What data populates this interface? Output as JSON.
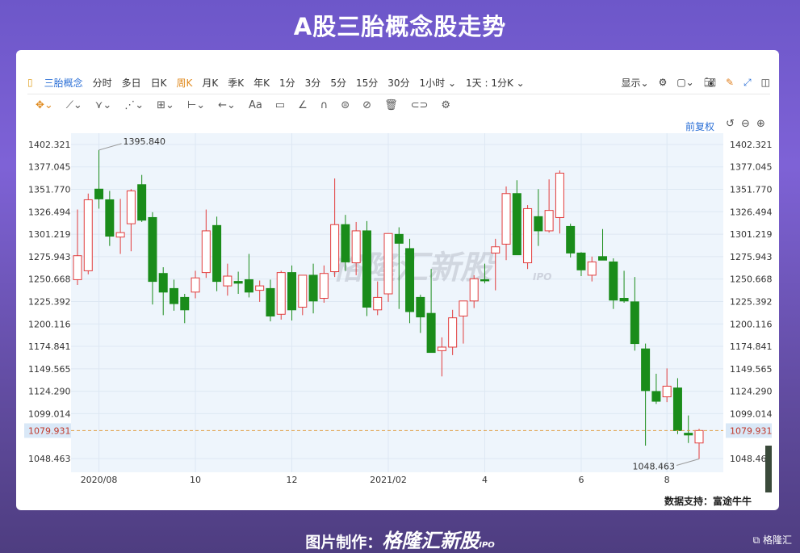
{
  "title": "A股三胎概念股走势",
  "toolbar": {
    "stock_name": "三胎概念",
    "periods": [
      "分时",
      "多日",
      "日K",
      "周K",
      "月K",
      "季K",
      "年K",
      "1分",
      "3分",
      "5分",
      "15分",
      "30分",
      "1小时 ⌄",
      "1天 : 1分K ⌄"
    ],
    "active_period": "周K",
    "display": "显示⌄"
  },
  "drawing_tools": [
    "✥⌄",
    "⟋⌄",
    "⋎⌄",
    "⋰⌄",
    "⊞⌄",
    "⊢⌄",
    "←⌄",
    "Aa",
    "▭",
    "∠",
    "∩",
    "⊜",
    "⊘",
    "🗑",
    "⊂⊃",
    "⚙"
  ],
  "restore_label": "前复权",
  "watermark": "格隆汇新股",
  "watermark_ipo": "IPO",
  "source": "数据支持：富途牛牛",
  "credit_label": "图片制作：",
  "credit_brand": "格隆汇新股",
  "credit_ipo": "IPO",
  "corner_brand": "格隆汇",
  "colors": {
    "up": "#e23c3c",
    "down": "#1a8c1a",
    "current_line": "#e09a3c",
    "axis_highlight": "#d9e8f7"
  },
  "chart_data": {
    "type": "candlestick",
    "title": "",
    "ylim": [
      1033,
      1415
    ],
    "y_ticks": [
      "1402.321",
      "1377.045",
      "1351.770",
      "1326.494",
      "1301.219",
      "1275.943",
      "1250.668",
      "1225.392",
      "1200.116",
      "1174.841",
      "1149.565",
      "1124.290",
      "1099.014",
      "1048.463"
    ],
    "x_tick_labels": [
      {
        "label": "2020/08",
        "index": 2
      },
      {
        "label": "10",
        "index": 11
      },
      {
        "label": "12",
        "index": 20
      },
      {
        "label": "2021/02",
        "index": 29
      },
      {
        "label": "4",
        "index": 38
      },
      {
        "label": "6",
        "index": 47
      },
      {
        "label": "8",
        "index": 55
      }
    ],
    "current_value": "1079.931",
    "high_annotation": {
      "label": "1395.840",
      "index": 2
    },
    "low_annotation": {
      "label": "1048.463",
      "index": 58
    },
    "candles": [
      {
        "o": 1250,
        "h": 1329,
        "l": 1244,
        "c": 1277
      },
      {
        "o": 1260,
        "h": 1347,
        "l": 1256,
        "c": 1340
      },
      {
        "o": 1352,
        "h": 1396,
        "l": 1330,
        "c": 1341
      },
      {
        "o": 1340,
        "h": 1350,
        "l": 1288,
        "c": 1299
      },
      {
        "o": 1298,
        "h": 1341,
        "l": 1279,
        "c": 1303
      },
      {
        "o": 1313,
        "h": 1352,
        "l": 1282,
        "c": 1350
      },
      {
        "o": 1357,
        "h": 1368,
        "l": 1315,
        "c": 1317
      },
      {
        "o": 1320,
        "h": 1326,
        "l": 1222,
        "c": 1248
      },
      {
        "o": 1257,
        "h": 1264,
        "l": 1210,
        "c": 1236
      },
      {
        "o": 1240,
        "h": 1250,
        "l": 1215,
        "c": 1223
      },
      {
        "o": 1230,
        "h": 1234,
        "l": 1201,
        "c": 1216
      },
      {
        "o": 1236,
        "h": 1260,
        "l": 1229,
        "c": 1252
      },
      {
        "o": 1258,
        "h": 1329,
        "l": 1252,
        "c": 1305
      },
      {
        "o": 1311,
        "h": 1321,
        "l": 1237,
        "c": 1248
      },
      {
        "o": 1243,
        "h": 1268,
        "l": 1232,
        "c": 1254
      },
      {
        "o": 1248,
        "h": 1259,
        "l": 1234,
        "c": 1246
      },
      {
        "o": 1250,
        "h": 1279,
        "l": 1230,
        "c": 1236
      },
      {
        "o": 1238,
        "h": 1249,
        "l": 1225,
        "c": 1243
      },
      {
        "o": 1240,
        "h": 1250,
        "l": 1203,
        "c": 1209
      },
      {
        "o": 1211,
        "h": 1260,
        "l": 1205,
        "c": 1258
      },
      {
        "o": 1258,
        "h": 1266,
        "l": 1204,
        "c": 1216
      },
      {
        "o": 1219,
        "h": 1248,
        "l": 1210,
        "c": 1255
      },
      {
        "o": 1255,
        "h": 1268,
        "l": 1212,
        "c": 1226
      },
      {
        "o": 1229,
        "h": 1266,
        "l": 1224,
        "c": 1257
      },
      {
        "o": 1259,
        "h": 1364,
        "l": 1253,
        "c": 1312
      },
      {
        "o": 1312,
        "h": 1323,
        "l": 1260,
        "c": 1270
      },
      {
        "o": 1269,
        "h": 1315,
        "l": 1255,
        "c": 1305
      },
      {
        "o": 1305,
        "h": 1316,
        "l": 1209,
        "c": 1219
      },
      {
        "o": 1216,
        "h": 1248,
        "l": 1210,
        "c": 1230
      },
      {
        "o": 1234,
        "h": 1295,
        "l": 1225,
        "c": 1302
      },
      {
        "o": 1301,
        "h": 1309,
        "l": 1217,
        "c": 1291
      },
      {
        "o": 1285,
        "h": 1296,
        "l": 1201,
        "c": 1214
      },
      {
        "o": 1230,
        "h": 1233,
        "l": 1190,
        "c": 1208
      },
      {
        "o": 1212,
        "h": 1262,
        "l": 1174,
        "c": 1168
      },
      {
        "o": 1170,
        "h": 1185,
        "l": 1141,
        "c": 1174
      },
      {
        "o": 1174,
        "h": 1216,
        "l": 1165,
        "c": 1207
      },
      {
        "o": 1209,
        "h": 1220,
        "l": 1178,
        "c": 1226
      },
      {
        "o": 1226,
        "h": 1255,
        "l": 1218,
        "c": 1251
      },
      {
        "o": 1250,
        "h": 1268,
        "l": 1246,
        "c": 1249
      },
      {
        "o": 1280,
        "h": 1296,
        "l": 1238,
        "c": 1287
      },
      {
        "o": 1290,
        "h": 1355,
        "l": 1272,
        "c": 1347
      },
      {
        "o": 1347,
        "h": 1362,
        "l": 1281,
        "c": 1278
      },
      {
        "o": 1269,
        "h": 1334,
        "l": 1262,
        "c": 1330
      },
      {
        "o": 1321,
        "h": 1352,
        "l": 1288,
        "c": 1305
      },
      {
        "o": 1305,
        "h": 1363,
        "l": 1303,
        "c": 1328
      },
      {
        "o": 1320,
        "h": 1373,
        "l": 1302,
        "c": 1370
      },
      {
        "o": 1310,
        "h": 1313,
        "l": 1275,
        "c": 1280
      },
      {
        "o": 1280,
        "h": 1281,
        "l": 1254,
        "c": 1261
      },
      {
        "o": 1255,
        "h": 1276,
        "l": 1248,
        "c": 1270
      },
      {
        "o": 1276,
        "h": 1307,
        "l": 1272,
        "c": 1272
      },
      {
        "o": 1270,
        "h": 1274,
        "l": 1217,
        "c": 1227
      },
      {
        "o": 1229,
        "h": 1260,
        "l": 1224,
        "c": 1226
      },
      {
        "o": 1225,
        "h": 1253,
        "l": 1170,
        "c": 1178
      },
      {
        "o": 1172,
        "h": 1178,
        "l": 1063,
        "c": 1125
      },
      {
        "o": 1124,
        "h": 1144,
        "l": 1110,
        "c": 1113
      },
      {
        "o": 1118,
        "h": 1150,
        "l": 1112,
        "c": 1130
      },
      {
        "o": 1128,
        "h": 1139,
        "l": 1076,
        "c": 1080
      },
      {
        "o": 1077,
        "h": 1097,
        "l": 1066,
        "c": 1075
      },
      {
        "o": 1066,
        "h": 1082,
        "l": 1048,
        "c": 1080
      }
    ]
  }
}
